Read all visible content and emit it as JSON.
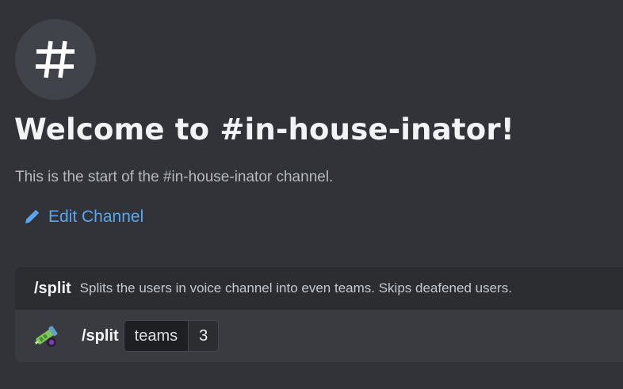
{
  "channel": {
    "icon": "hashtag-icon",
    "welcome_title": "Welcome to #in-house-inator!",
    "welcome_subtitle": "This is the start of the #in-house-inator channel.",
    "edit_link": {
      "icon": "pencil-icon",
      "label": "Edit Channel"
    }
  },
  "command_suggestion": {
    "name": "/split",
    "description": "Splits the users in voice channel into even teams. Skips deafened users.",
    "bot_avatar": "bot-avatar-icon",
    "input": {
      "command": "/split",
      "option_name": "teams",
      "option_value": "3"
    }
  },
  "colors": {
    "background": "#313338",
    "link": "#5aa6f0",
    "header": "#2b2d31",
    "row": "#393b41"
  }
}
